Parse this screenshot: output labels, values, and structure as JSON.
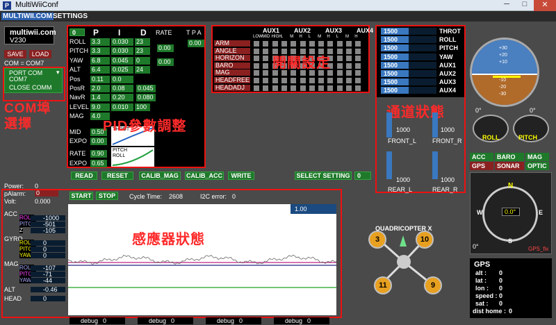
{
  "window": {
    "title": "MultiWiiConf",
    "app_icon": "P",
    "minimize": "─",
    "maximize": "□",
    "close": "✕"
  },
  "menu": {
    "tab1": "MULTIWII.COM",
    "tab2": "SETTINGS"
  },
  "header": {
    "brand": "multiwii.com",
    "version": "V230",
    "save": "SAVE",
    "load": "LOAD",
    "com_status": "COM = COM7",
    "port_select": "PORT COM",
    "port_value": "COM7",
    "close_comm": "CLOSE COMM"
  },
  "pid": {
    "toggle": "0",
    "col_p": "P",
    "col_i": "I",
    "col_d": "D",
    "col_rate": "RATE",
    "col_tpa": "T P A",
    "rows": [
      {
        "name": "ROLL",
        "p": "3.3",
        "i": "0.030",
        "d": "23"
      },
      {
        "name": "PITCH",
        "p": "3.3",
        "i": "0.030",
        "d": "23"
      },
      {
        "name": "YAW",
        "p": "6.8",
        "i": "0.045",
        "d": "0"
      },
      {
        "name": "ALT",
        "p": "6.4",
        "i": "0.025",
        "d": "24"
      },
      {
        "name": "Pos",
        "p": "0.11",
        "i": "0.0",
        "d": ""
      },
      {
        "name": "PosR",
        "p": "2.0",
        "i": "0.08",
        "d": "0.045"
      },
      {
        "name": "NavR",
        "p": "1.4",
        "i": "0.20",
        "d": "0.080"
      },
      {
        "name": "LEVEL",
        "p": "9.0",
        "i": "0.010",
        "d": "100"
      },
      {
        "name": "MAG",
        "p": "4.0",
        "i": "",
        "d": ""
      }
    ],
    "rate_roll_pitch": "0.00",
    "rate_yaw": "0.00",
    "tpa": "0.00",
    "mid_label": "MID",
    "mid": "0.50",
    "expo_label": "EXPO",
    "expo": "0.00",
    "throt_label": "THROT",
    "rate_label": "RATE",
    "rate": "0.90",
    "expo2_label": "EXPO",
    "expo2": "0.65",
    "pitch_roll_label": "PITCH ROLL"
  },
  "aux": {
    "headers": [
      "AUX1",
      "AUX2",
      "AUX3",
      "AUX4"
    ],
    "subheaders": [
      "LOW",
      "MID",
      "HIGH",
      "L",
      "M",
      "H",
      "L",
      "M",
      "H",
      "L",
      "M",
      "H"
    ],
    "rows": [
      "ARM",
      "ANGLE",
      "HORIZON",
      "BARO",
      "MAG",
      "HEADFREE",
      "HEADADJ"
    ]
  },
  "rc": {
    "channels": [
      {
        "value": "1500",
        "name": "THROT"
      },
      {
        "value": "1500",
        "name": "ROLL"
      },
      {
        "value": "1500",
        "name": "PITCH"
      },
      {
        "value": "1500",
        "name": "YAW"
      },
      {
        "value": "1500",
        "name": "AUX1"
      },
      {
        "value": "1500",
        "name": "AUX2"
      },
      {
        "value": "1500",
        "name": "AUX3"
      },
      {
        "value": "1500",
        "name": "AUX4"
      }
    ]
  },
  "motors": {
    "front_l_value": "1000",
    "front_l": "FRONT_L",
    "front_r_value": "1000",
    "front_r": "FRONT_R",
    "rear_l_value": "1000",
    "rear_l": "REAR_L",
    "rear_r_value": "1000",
    "rear_r": "REAR_R"
  },
  "annotations": {
    "com": "COM埠\n選擇",
    "pid": "PID參數調整",
    "aux": "開關設定",
    "channel": "通道狀態",
    "sensor": "感應器狀態"
  },
  "buttons": {
    "read": "READ",
    "reset": "RESET",
    "calib_mag": "CALIB_MAG",
    "calib_acc": "CALIB_ACC",
    "write": "WRITE",
    "select_setting": "SELECT SETTING",
    "setting_value": "0",
    "start": "START",
    "stop": "STOP"
  },
  "status": {
    "power_label": "Power:",
    "power": "0",
    "palarm_label": "pAlarm:",
    "palarm": "0",
    "volt_label": "Volt:",
    "volt": "0.000",
    "cycle_label": "Cycle Time:",
    "cycle": "2608",
    "i2c_label": "I2C error:",
    "i2c": "0",
    "graph_scale": "1.00"
  },
  "sensors": {
    "acc": "ACC",
    "acc_roll": "-1000",
    "acc_pitch": "-501",
    "acc_z": "-105",
    "gyro": "GYRO",
    "gyro_roll": "0",
    "gyro_pitch": "0",
    "gyro_yaw": "0",
    "mag": "MAG",
    "mag_roll": "-107",
    "mag_pitch": "-71",
    "mag_yaw": "-44",
    "alt": "ALT",
    "alt_value": "-0.46",
    "head": "HEAD",
    "head_value": "0",
    "roll_l": "ROLL",
    "pitch_l": "PITCH",
    "z_l": "Z",
    "yaw_l": "YAW"
  },
  "debug": {
    "label": "debug",
    "values": [
      "0",
      "0",
      "0",
      "0"
    ]
  },
  "instruments": {
    "horizon_ticks": [
      "+30",
      "+20",
      "+10",
      "-10",
      "-20",
      "-30"
    ],
    "roll_deg": "0°",
    "pitch_deg": "0°",
    "roll": "ROLL",
    "pitch": "PITCH",
    "flags": [
      {
        "label": "ACC",
        "active": true
      },
      {
        "label": "BARO",
        "active": true
      },
      {
        "label": "MAG",
        "active": true
      },
      {
        "label": "GPS",
        "active": false
      },
      {
        "label": "SONAR",
        "active": false
      },
      {
        "label": "OPTIC",
        "active": true
      }
    ],
    "compass_n": "N",
    "compass_e": "E",
    "compass_s": "S",
    "compass_w": "W",
    "heading": "0.0°",
    "compass_deg": "0°",
    "gps_fix": "GPS_fix"
  },
  "quad": {
    "label": "QUADRICOPTER X",
    "motors": [
      "3",
      "10",
      "11",
      "9"
    ]
  },
  "gps": {
    "title": "GPS",
    "alt_label": "alt :",
    "alt": "0",
    "lat_label": "lat :",
    "lat": "0",
    "lon_label": "lon :",
    "lon": "0",
    "speed_label": "speed :",
    "speed": "0",
    "sat_label": "sat :",
    "sat": "0",
    "dist_label": "dist home :",
    "dist": "0"
  }
}
